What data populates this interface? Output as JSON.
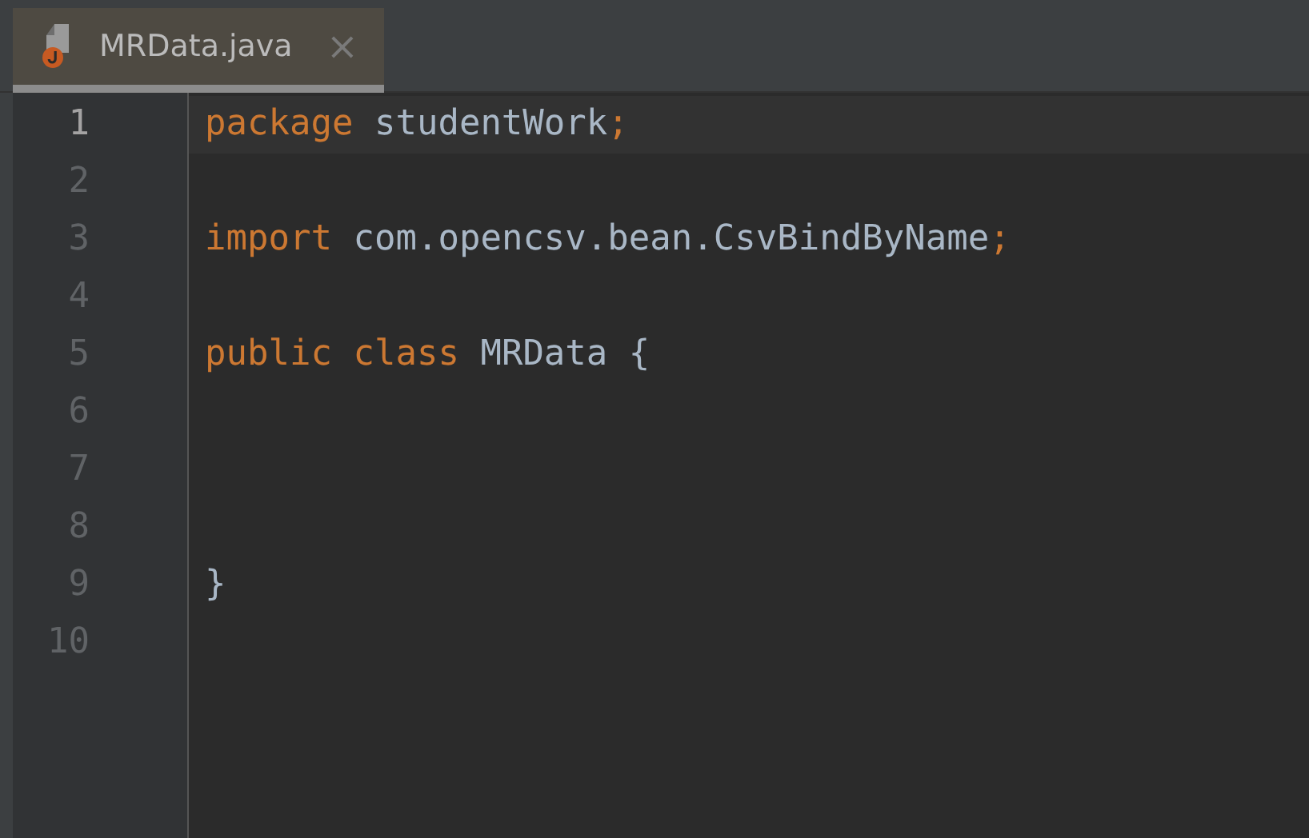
{
  "tabs": [
    {
      "label": "MRData.java",
      "selected": true,
      "close": "×"
    }
  ],
  "lines": [
    {
      "number": "1",
      "current": true,
      "tokens": [
        {
          "kind": "keyword",
          "text": "package"
        },
        {
          "kind": "plain",
          "text": " studentWork"
        },
        {
          "kind": "keyword",
          "text": ";"
        }
      ]
    },
    {
      "number": "2",
      "current": false
    },
    {
      "number": "3",
      "current": false,
      "tokens": [
        {
          "kind": "keyword",
          "text": "import"
        },
        {
          "kind": "plain",
          "text": " com.opencsv.bean.CsvBindByName"
        },
        {
          "kind": "keyword",
          "text": ";"
        }
      ]
    },
    {
      "number": "4",
      "current": false
    },
    {
      "number": "5",
      "current": false,
      "tokens": [
        {
          "kind": "keyword",
          "text": "public class"
        },
        {
          "kind": "plain",
          "text": " MRData {"
        }
      ]
    },
    {
      "number": "6",
      "current": false
    },
    {
      "number": "7",
      "current": false
    },
    {
      "number": "8",
      "current": false
    },
    {
      "number": "9",
      "current": false,
      "tokens": [
        {
          "kind": "plain",
          "text": "}"
        }
      ]
    },
    {
      "number": "10",
      "current": false
    }
  ]
}
